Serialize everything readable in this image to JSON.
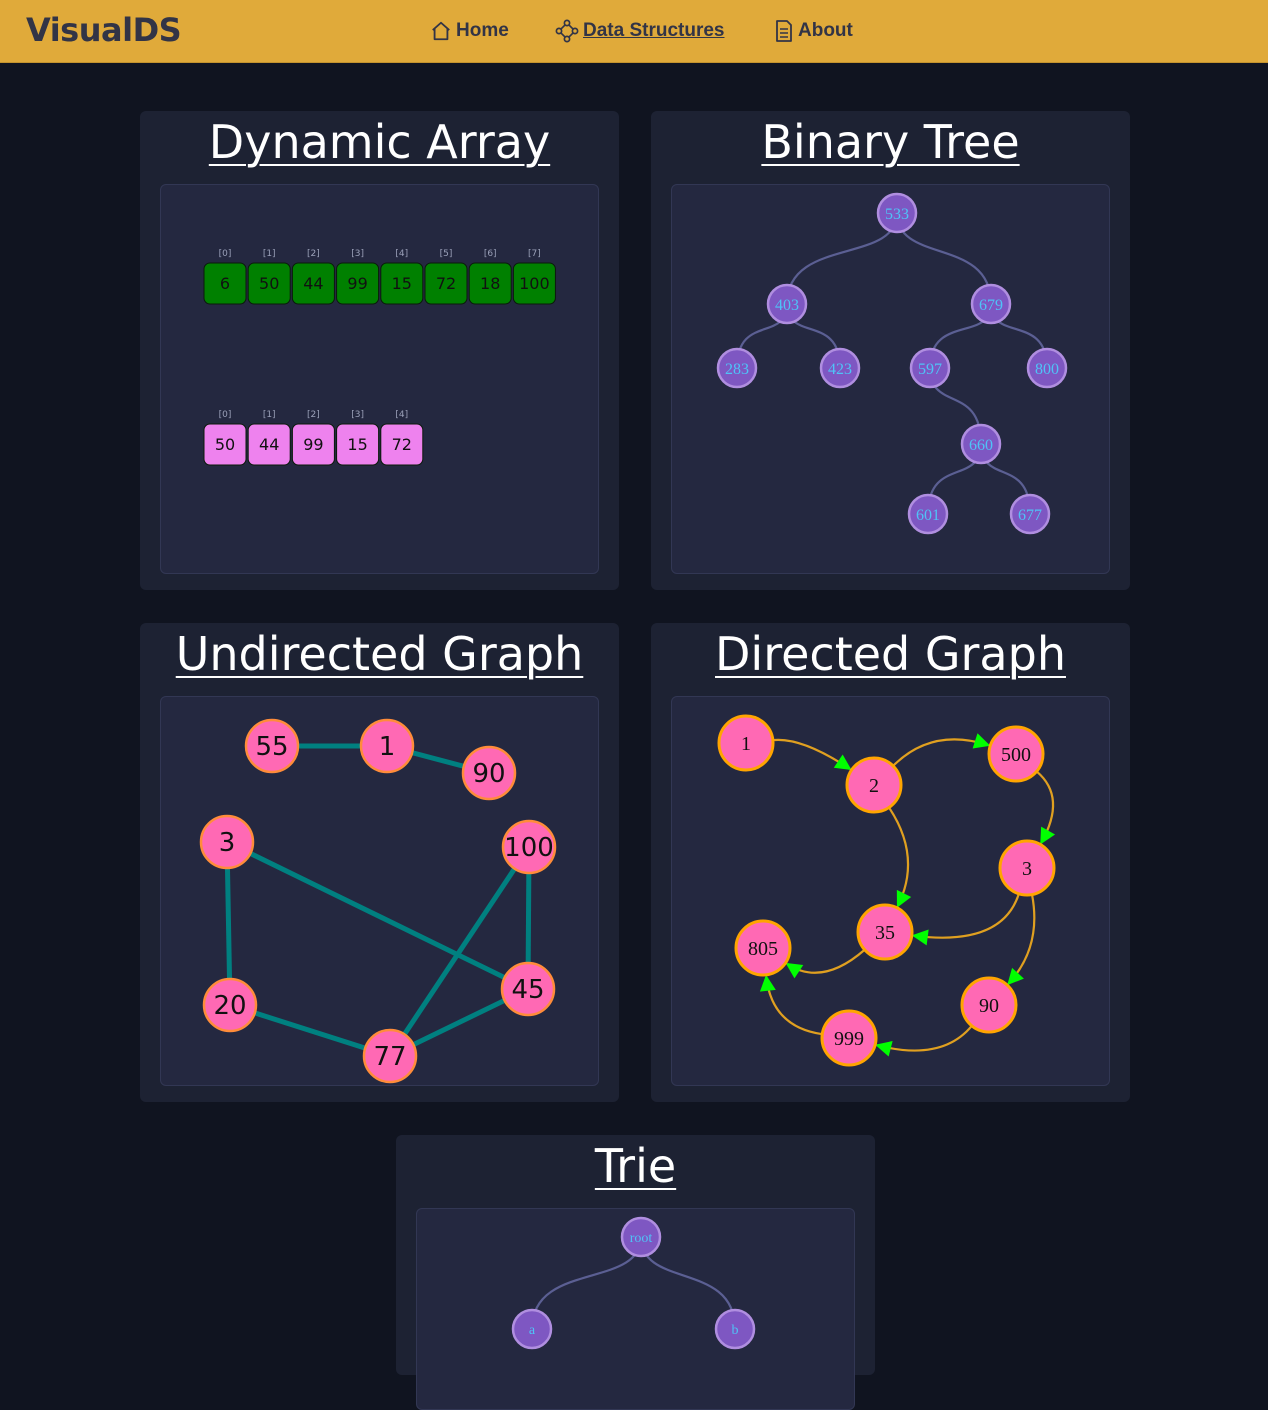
{
  "nav": {
    "brand": "VisualDS",
    "links": [
      {
        "label": "Home",
        "icon": "home-icon"
      },
      {
        "label": "Data Structures",
        "icon": "graph-nodes-icon",
        "active": true
      },
      {
        "label": "About",
        "icon": "document-icon"
      }
    ]
  },
  "cards": {
    "dynamic_array": {
      "title": "Dynamic Array",
      "arrays": [
        {
          "indices": [
            "[0]",
            "[1]",
            "[2]",
            "[3]",
            "[4]",
            "[5]",
            "[6]",
            "[7]"
          ],
          "values": [
            "6",
            "50",
            "44",
            "99",
            "15",
            "72",
            "18",
            "100"
          ],
          "color": "#008000"
        },
        {
          "indices": [
            "[0]",
            "[1]",
            "[2]",
            "[3]",
            "[4]"
          ],
          "values": [
            "50",
            "44",
            "99",
            "15",
            "72"
          ],
          "color": "#ee82ee"
        }
      ]
    },
    "binary_tree": {
      "title": "Binary Tree",
      "nodes": [
        "533",
        "403",
        "679",
        "283",
        "423",
        "597",
        "800",
        "660",
        "601",
        "677"
      ],
      "edges": [
        [
          "533",
          "403"
        ],
        [
          "533",
          "679"
        ],
        [
          "403",
          "283"
        ],
        [
          "403",
          "423"
        ],
        [
          "679",
          "597"
        ],
        [
          "679",
          "800"
        ],
        [
          "597",
          "660"
        ],
        [
          "660",
          "601"
        ],
        [
          "660",
          "677"
        ]
      ]
    },
    "undirected_graph": {
      "title": "Undirected Graph",
      "nodes": [
        "55",
        "1",
        "90",
        "3",
        "100",
        "20",
        "45",
        "77"
      ],
      "edges": [
        [
          "55",
          "1"
        ],
        [
          "1",
          "90"
        ],
        [
          "3",
          "20"
        ],
        [
          "3",
          "45"
        ],
        [
          "100",
          "45"
        ],
        [
          "100",
          "77"
        ],
        [
          "20",
          "77"
        ],
        [
          "77",
          "45"
        ]
      ]
    },
    "directed_graph": {
      "title": "Directed Graph",
      "nodes": [
        "1",
        "2",
        "500",
        "3",
        "35",
        "805",
        "90",
        "999"
      ],
      "edges": [
        [
          "1",
          "2"
        ],
        [
          "2",
          "500"
        ],
        [
          "500",
          "3"
        ],
        [
          "2",
          "35"
        ],
        [
          "3",
          "35"
        ],
        [
          "35",
          "805"
        ],
        [
          "3",
          "90"
        ],
        [
          "90",
          "999"
        ],
        [
          "999",
          "805"
        ]
      ]
    },
    "trie": {
      "title": "Trie",
      "nodes": [
        "root",
        "a",
        "b"
      ],
      "edges": [
        [
          "root",
          "a"
        ],
        [
          "root",
          "b"
        ]
      ]
    }
  },
  "colors": {
    "navbar": "#e0aa3a",
    "tree_node_fill": "#7e57c2",
    "tree_node_text": "#4fc3f7",
    "graph_node_fill": "#ff69b4",
    "undirected_edge": "#008080",
    "directed_edge": "#e0a020",
    "arrow_head": "#00ff00"
  }
}
